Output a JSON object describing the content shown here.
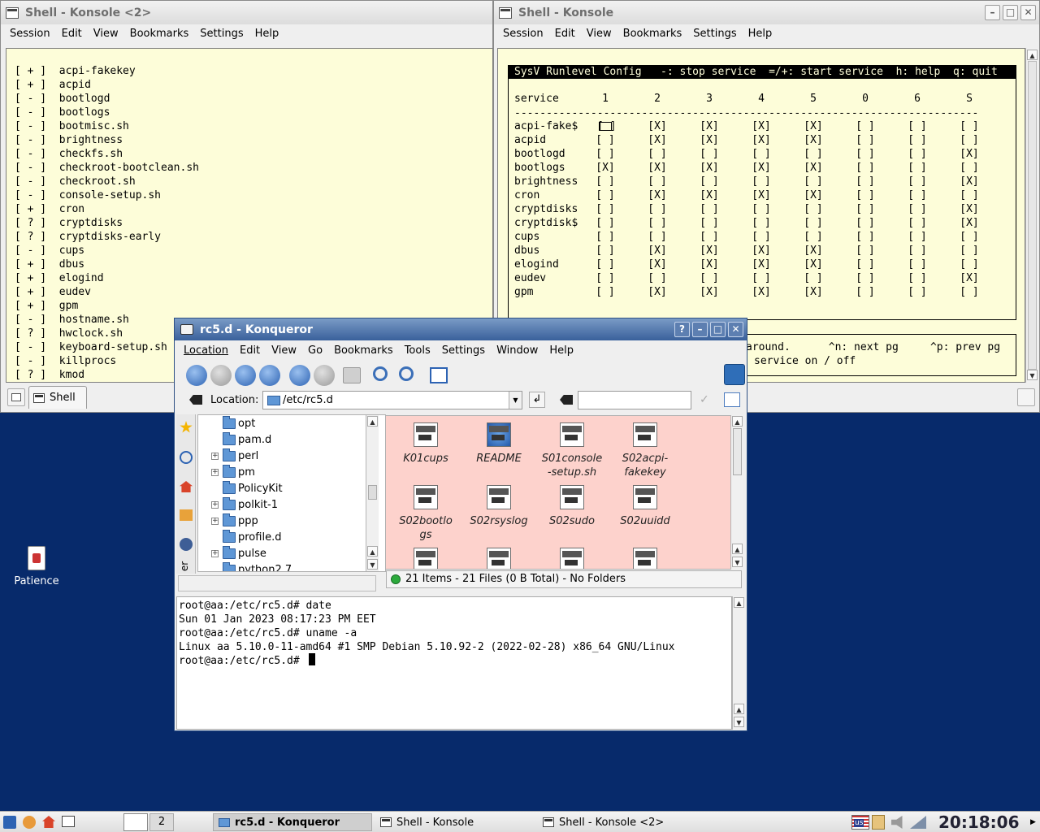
{
  "left_konsole": {
    "title": "Shell - Konsole <2>",
    "menu": [
      "Session",
      "Edit",
      "View",
      "Bookmarks",
      "Settings",
      "Help"
    ],
    "lines": [
      "[ + ]  acpi-fakekey",
      "[ + ]  acpid",
      "[ - ]  bootlogd",
      "[ - ]  bootlogs",
      "[ - ]  bootmisc.sh",
      "[ - ]  brightness",
      "[ - ]  checkfs.sh",
      "[ - ]  checkroot-bootclean.sh",
      "[ - ]  checkroot.sh",
      "[ - ]  console-setup.sh",
      "[ + ]  cron",
      "[ ? ]  cryptdisks",
      "[ ? ]  cryptdisks-early",
      "[ - ]  cups",
      "[ + ]  dbus",
      "[ + ]  elogind",
      "[ + ]  eudev",
      "[ + ]  gpm",
      "[ - ]  hostname.sh",
      "[ ? ]  hwclock.sh",
      "[ - ]  keyboard-setup.sh",
      "[ - ]  killprocs",
      "[ ? ]  kmod"
    ],
    "tab_label": "Shell"
  },
  "right_konsole": {
    "title": "Shell - Konsole",
    "menu": [
      "Session",
      "Edit",
      "View",
      "Bookmarks",
      "Settings",
      "Help"
    ],
    "header": "SysV Runlevel Config   -: stop service  =/+: start service  h: help  q: quit",
    "columns": [
      "service",
      "1",
      "2",
      "3",
      "4",
      "5",
      "0",
      "6",
      "S"
    ],
    "separator": "-------------------------------------------------------------------------",
    "rows": [
      {
        "name": "acpi-fake$",
        "v": [
          "[ ]",
          "[X]",
          "[X]",
          "[X]",
          "[X]",
          "[ ]",
          "[ ]",
          "[ ]"
        ]
      },
      {
        "name": "acpid",
        "v": [
          "[ ]",
          "[X]",
          "[X]",
          "[X]",
          "[X]",
          "[ ]",
          "[ ]",
          "[ ]"
        ]
      },
      {
        "name": "bootlogd",
        "v": [
          "[ ]",
          "[ ]",
          "[ ]",
          "[ ]",
          "[ ]",
          "[ ]",
          "[ ]",
          "[X]"
        ]
      },
      {
        "name": "bootlogs",
        "v": [
          "[X]",
          "[X]",
          "[X]",
          "[X]",
          "[X]",
          "[ ]",
          "[ ]",
          "[ ]"
        ]
      },
      {
        "name": "brightness",
        "v": [
          "[ ]",
          "[ ]",
          "[ ]",
          "[ ]",
          "[ ]",
          "[ ]",
          "[ ]",
          "[X]"
        ]
      },
      {
        "name": "cron",
        "v": [
          "[ ]",
          "[X]",
          "[X]",
          "[X]",
          "[X]",
          "[ ]",
          "[ ]",
          "[ ]"
        ]
      },
      {
        "name": "cryptdisks",
        "v": [
          "[ ]",
          "[ ]",
          "[ ]",
          "[ ]",
          "[ ]",
          "[ ]",
          "[ ]",
          "[X]"
        ]
      },
      {
        "name": "cryptdisk$",
        "v": [
          "[ ]",
          "[ ]",
          "[ ]",
          "[ ]",
          "[ ]",
          "[ ]",
          "[ ]",
          "[X]"
        ]
      },
      {
        "name": "cups",
        "v": [
          "[ ]",
          "[ ]",
          "[ ]",
          "[ ]",
          "[ ]",
          "[ ]",
          "[ ]",
          "[ ]"
        ]
      },
      {
        "name": "dbus",
        "v": [
          "[ ]",
          "[X]",
          "[X]",
          "[X]",
          "[X]",
          "[ ]",
          "[ ]",
          "[ ]"
        ]
      },
      {
        "name": "elogind",
        "v": [
          "[ ]",
          "[X]",
          "[X]",
          "[X]",
          "[X]",
          "[ ]",
          "[ ]",
          "[ ]"
        ]
      },
      {
        "name": "eudev",
        "v": [
          "[ ]",
          "[ ]",
          "[ ]",
          "[ ]",
          "[ ]",
          "[ ]",
          "[ ]",
          "[X]"
        ]
      },
      {
        "name": "gpm",
        "v": [
          "[ ]",
          "[X]",
          "[X]",
          "[X]",
          "[X]",
          "[ ]",
          "[ ]",
          "[ ]"
        ]
      }
    ],
    "footer_line1": "around.      ^n: next pg     ^p: prev pg",
    "footer_line2": "service on / off"
  },
  "konqueror": {
    "title": "rc5.d - Konqueror",
    "title_buttons": [
      "?",
      "–",
      "□",
      "✕"
    ],
    "menu": [
      "Location",
      "Edit",
      "View",
      "Go",
      "Bookmarks",
      "Tools",
      "Settings",
      "Window",
      "Help"
    ],
    "location_label": "Location:",
    "location_value": "/etc/rc5.d",
    "tree": [
      {
        "name": "opt",
        "exp": false
      },
      {
        "name": "pam.d",
        "exp": false
      },
      {
        "name": "perl",
        "exp": true
      },
      {
        "name": "pm",
        "exp": true
      },
      {
        "name": "PolicyKit",
        "exp": false
      },
      {
        "name": "polkit-1",
        "exp": true
      },
      {
        "name": "ppp",
        "exp": true
      },
      {
        "name": "profile.d",
        "exp": false
      },
      {
        "name": "pulse",
        "exp": true
      },
      {
        "name": "python2.7",
        "exp": false
      }
    ],
    "files": [
      {
        "l1": "K01cups",
        "l2": ""
      },
      {
        "l1": "README",
        "l2": ""
      },
      {
        "l1": "S01console",
        "l2": "-setup.sh"
      },
      {
        "l1": "S02acpi-",
        "l2": "fakekey"
      },
      {
        "l1": "S02bootlo",
        "l2": "gs"
      },
      {
        "l1": "S02rsyslog",
        "l2": ""
      },
      {
        "l1": "S02sudo",
        "l2": ""
      },
      {
        "l1": "S02uuidd",
        "l2": ""
      }
    ],
    "status": "21 Items - 21 Files (0 B Total) - No Folders",
    "sidebar_tab": "er",
    "terminal": [
      "root@aa:/etc/rc5.d# date",
      "Sun 01 Jan 2023 08:17:23 PM EET",
      "root@aa:/etc/rc5.d# uname -a",
      "Linux aa 5.10.0-11-amd64 #1 SMP Debian 5.10.92-2 (2022-02-28) x86_64 GNU/Linux",
      "root@aa:/etc/rc5.d# "
    ]
  },
  "desktop": {
    "icon_label": "Patience"
  },
  "taskbar": {
    "desktop_num": "2",
    "items": [
      "rc5.d - Konqueror",
      "Shell - Konsole",
      "Shell - Konsole <2>"
    ],
    "clock": "20:18:06",
    "kbd": "us"
  }
}
